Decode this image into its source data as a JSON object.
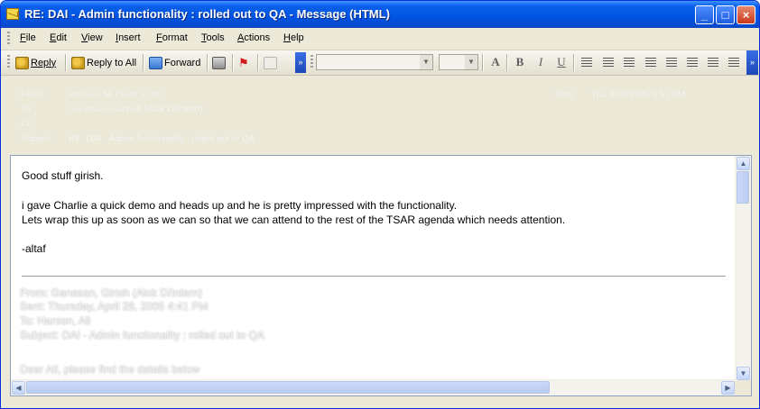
{
  "window": {
    "title": "RE: DAI - Admin functionality : rolled out to QA - Message (HTML)",
    "controls": {
      "minimize": "_",
      "maximize": "□",
      "close": "×"
    }
  },
  "menu": [
    "File",
    "Edit",
    "View",
    "Insert",
    "Format",
    "Tools",
    "Actions",
    "Help"
  ],
  "toolbar": {
    "reply": "Reply",
    "reply_all": "Reply to All",
    "forward": "Forward",
    "format": {
      "font_size_label": "A",
      "bold": "B",
      "italic": "I",
      "underline": "U"
    }
  },
  "header": {
    "from_label": "From:",
    "from_value": "Haroon, Ali (Sent: Cuts)",
    "to_label": "To:",
    "to_value": "Ganesan, Ganesh (Alok D/Intern)",
    "cc_label": "Cc:",
    "cc_value": "",
    "subject_label": "Subject:",
    "subject_value": "RE: DAI - Admin functionality : rolled out to QA",
    "sent_label": "Sent:",
    "sent_value": "Thu 4/28/2005 4:51 PM"
  },
  "body": {
    "lines": [
      "Good stuff girish.",
      "i gave Charlie a quick demo and heads up and he is pretty impressed with the functionality.",
      "Lets wrap this up as soon as we can so that we can attend to the rest of the TSAR agenda which needs attention.",
      "-altaf"
    ],
    "quoted": [
      "From: Ganesan, Girish (Alok D/Intern)",
      "Sent: Thursday, April 28, 2005 4:41 PM",
      "To: Haroon, Ali",
      "Subject: DAI - Admin functionality : rolled out to QA",
      "Dear Ali, please find the details below"
    ]
  },
  "colors": {
    "title_bar": "#0054E3",
    "window_face": "#ECE9D8",
    "body_background": "#FFFFFF"
  }
}
